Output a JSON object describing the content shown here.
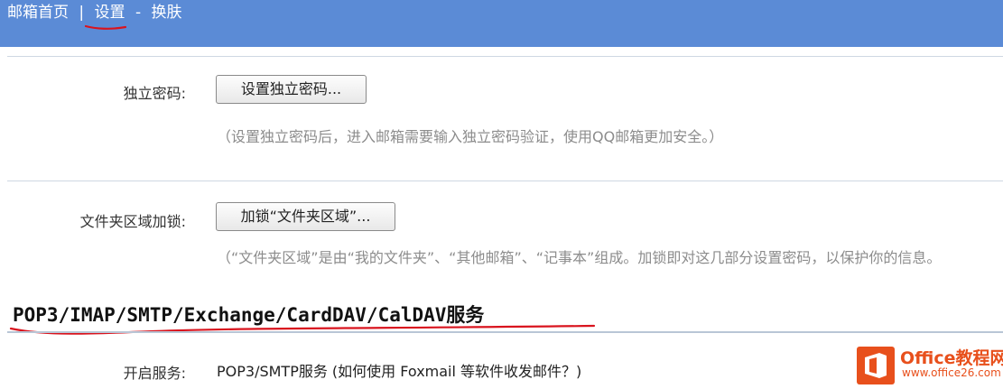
{
  "topnav": {
    "home": "邮箱首页",
    "separator": "|",
    "settings": "设置",
    "dash": "-",
    "skin": "换肤"
  },
  "independent_password": {
    "label": "独立密码:",
    "button": "设置独立密码...",
    "hint": "（设置独立密码后，进入邮箱需要输入独立密码验证，使用QQ邮箱更加安全。）"
  },
  "folder_lock": {
    "label": "文件夹区域加锁:",
    "button": "加锁“文件夹区域”...",
    "hint": "（“文件夹区域”是由“我的文件夹”、“其他邮箱”、“记事本”组成。加锁即对这几部分设置密码，以保护你的信息。"
  },
  "section": {
    "title": "POP3/IMAP/SMTP/Exchange/CardDAV/CalDAV服务"
  },
  "service": {
    "label": "开启服务:",
    "text": "POP3/SMTP服务 (如何使用 Foxmail 等软件收发邮件？)"
  },
  "watermark": {
    "title": "Office教程网",
    "url": "www.office26.com"
  },
  "colors": {
    "topbar": "#5b8bd6",
    "annotation_red": "#d9141e",
    "watermark_orange": "#e8501c"
  }
}
